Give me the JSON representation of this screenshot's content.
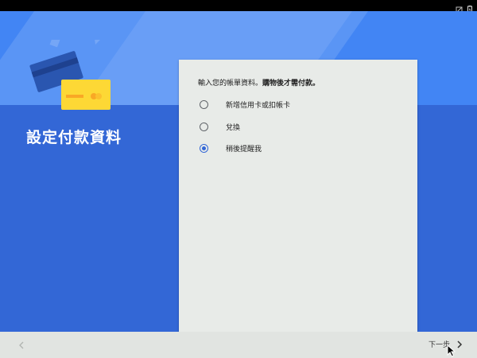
{
  "page": {
    "title": "設定付款資料"
  },
  "card": {
    "instruction_normal": "輸入您的帳單資料。",
    "instruction_bold": "購物後才需付款。",
    "options": [
      {
        "label": "新增信用卡或扣帳卡",
        "checked": false
      },
      {
        "label": "兌換",
        "checked": false
      },
      {
        "label": "稍後提醒我",
        "checked": true
      }
    ]
  },
  "footer": {
    "next_label": "下一步"
  },
  "icons": {
    "status": [
      "no-sim-icon",
      "battery-icon"
    ],
    "back": "chevron-left-icon",
    "next": "chevron-right-icon"
  },
  "colors": {
    "accent": "#3367d6",
    "hero": "#4285f4",
    "card_background": "#e8ebe8",
    "footer_background": "#e1e4e1"
  }
}
